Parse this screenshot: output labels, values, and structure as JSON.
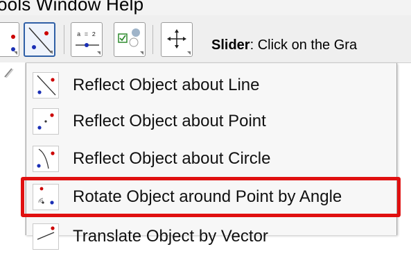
{
  "menubar": {
    "text": "ools   Window   Help"
  },
  "toolbar": {
    "slider_help_bold": "Slider",
    "slider_help_rest": ": Click on the Gra",
    "tool_value_label": "a = 2"
  },
  "menu": {
    "items": [
      {
        "label": "Reflect Object about Line",
        "icon": "reflect-line-icon"
      },
      {
        "label": "Reflect Object about Point",
        "icon": "reflect-point-icon"
      },
      {
        "label": "Reflect Object about Circle",
        "icon": "reflect-circle-icon"
      },
      {
        "label": "Rotate Object around Point by Angle",
        "icon": "rotate-icon",
        "highlighted": true
      },
      {
        "label": "Translate Object by Vector",
        "icon": "translate-vector-icon"
      }
    ]
  },
  "colors": {
    "highlight": "#e01010",
    "active_tool": "#2f5fa6",
    "point_red": "#cc0000",
    "point_blue": "#1a2fb5"
  }
}
